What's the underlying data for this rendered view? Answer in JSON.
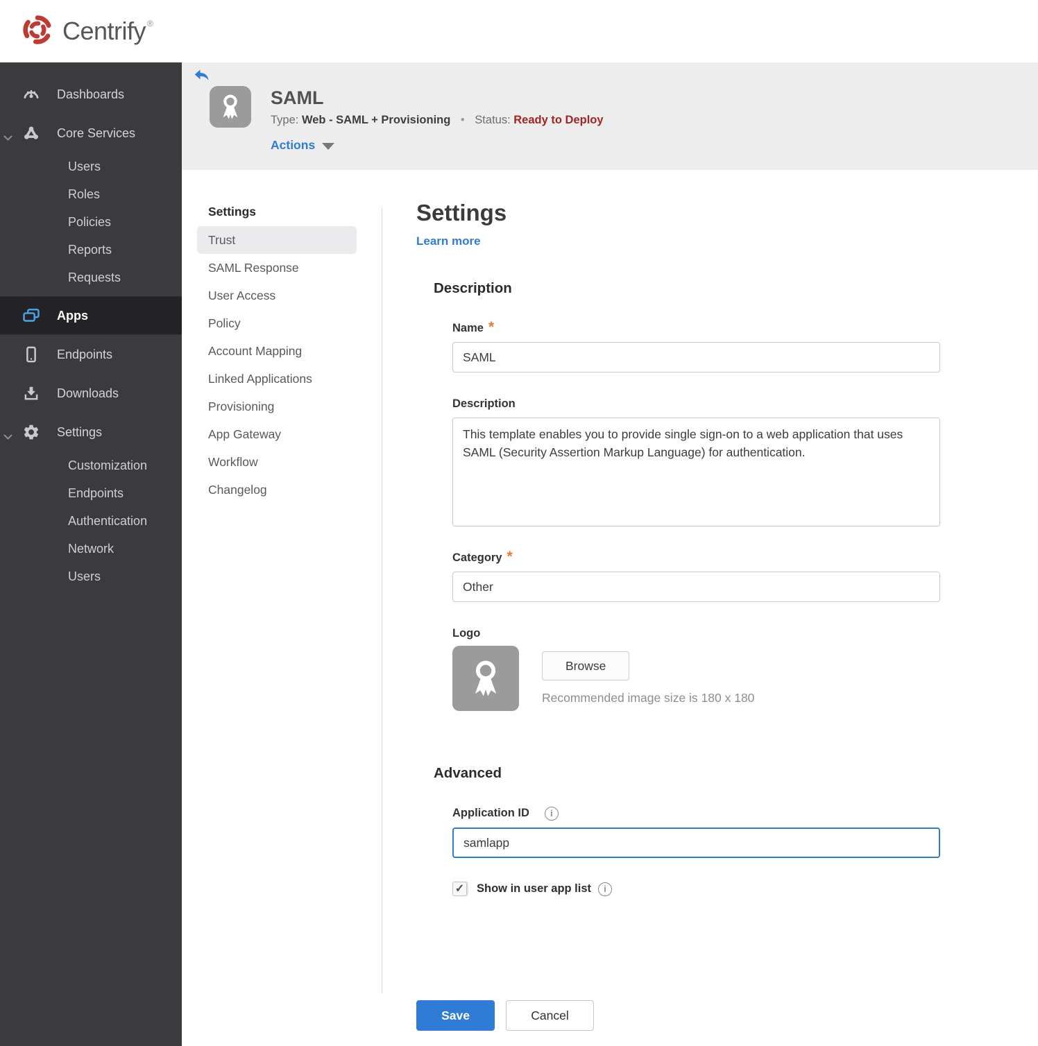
{
  "icons": {
    "registered": "®",
    "bullet": "•",
    "required": "*",
    "info_letter": "i",
    "check": "✓"
  },
  "colors": {
    "accent_blue": "#2e7cd6",
    "status_red": "#a32424",
    "required_orange": "#e87a33",
    "sidebar_bg": "#3b3b3d",
    "sidebar_active_bg": "#232325",
    "apps_icon_blue": "#45a1e0",
    "header_bg": "#ededee",
    "brand_red": "#bf3a33"
  },
  "topbar": {
    "brand": "Centrify"
  },
  "sidebar": {
    "dashboards": "Dashboards",
    "core_services": "Core Services",
    "core_children": [
      "Users",
      "Roles",
      "Policies",
      "Reports",
      "Requests"
    ],
    "apps": "Apps",
    "endpoints": "Endpoints",
    "downloads": "Downloads",
    "settings": "Settings",
    "settings_children": [
      "Customization",
      "Endpoints",
      "Authentication",
      "Network",
      "Users"
    ]
  },
  "app_header": {
    "title": "SAML",
    "type_label": "Type:",
    "type_value": "Web - SAML + Provisioning",
    "status_label": "Status:",
    "status_value": "Ready to Deploy",
    "actions_label": "Actions"
  },
  "subnav": {
    "header": "Settings",
    "active_item": "Trust",
    "items": [
      "Trust",
      "SAML Response",
      "User Access",
      "Policy",
      "Account Mapping",
      "Linked Applications",
      "Provisioning",
      "App Gateway",
      "Workflow",
      "Changelog"
    ]
  },
  "main": {
    "title": "Settings",
    "learn_more": "Learn more",
    "description": {
      "header": "Description",
      "name_label": "Name",
      "name_value": "SAML",
      "description_label": "Description",
      "description_value": "This template enables you to provide single sign-on to a web application that uses SAML (Security Assertion Markup Language) for authentication.",
      "category_label": "Category",
      "category_value": "Other",
      "logo_label": "Logo",
      "browse_label": "Browse",
      "logo_hint": "Recommended image size is 180 x 180"
    },
    "advanced": {
      "header": "Advanced",
      "app_id_label": "Application ID",
      "app_id_value": "samlapp",
      "show_label": "Show in user app list",
      "show_checked": true
    },
    "save_label": "Save",
    "cancel_label": "Cancel"
  }
}
